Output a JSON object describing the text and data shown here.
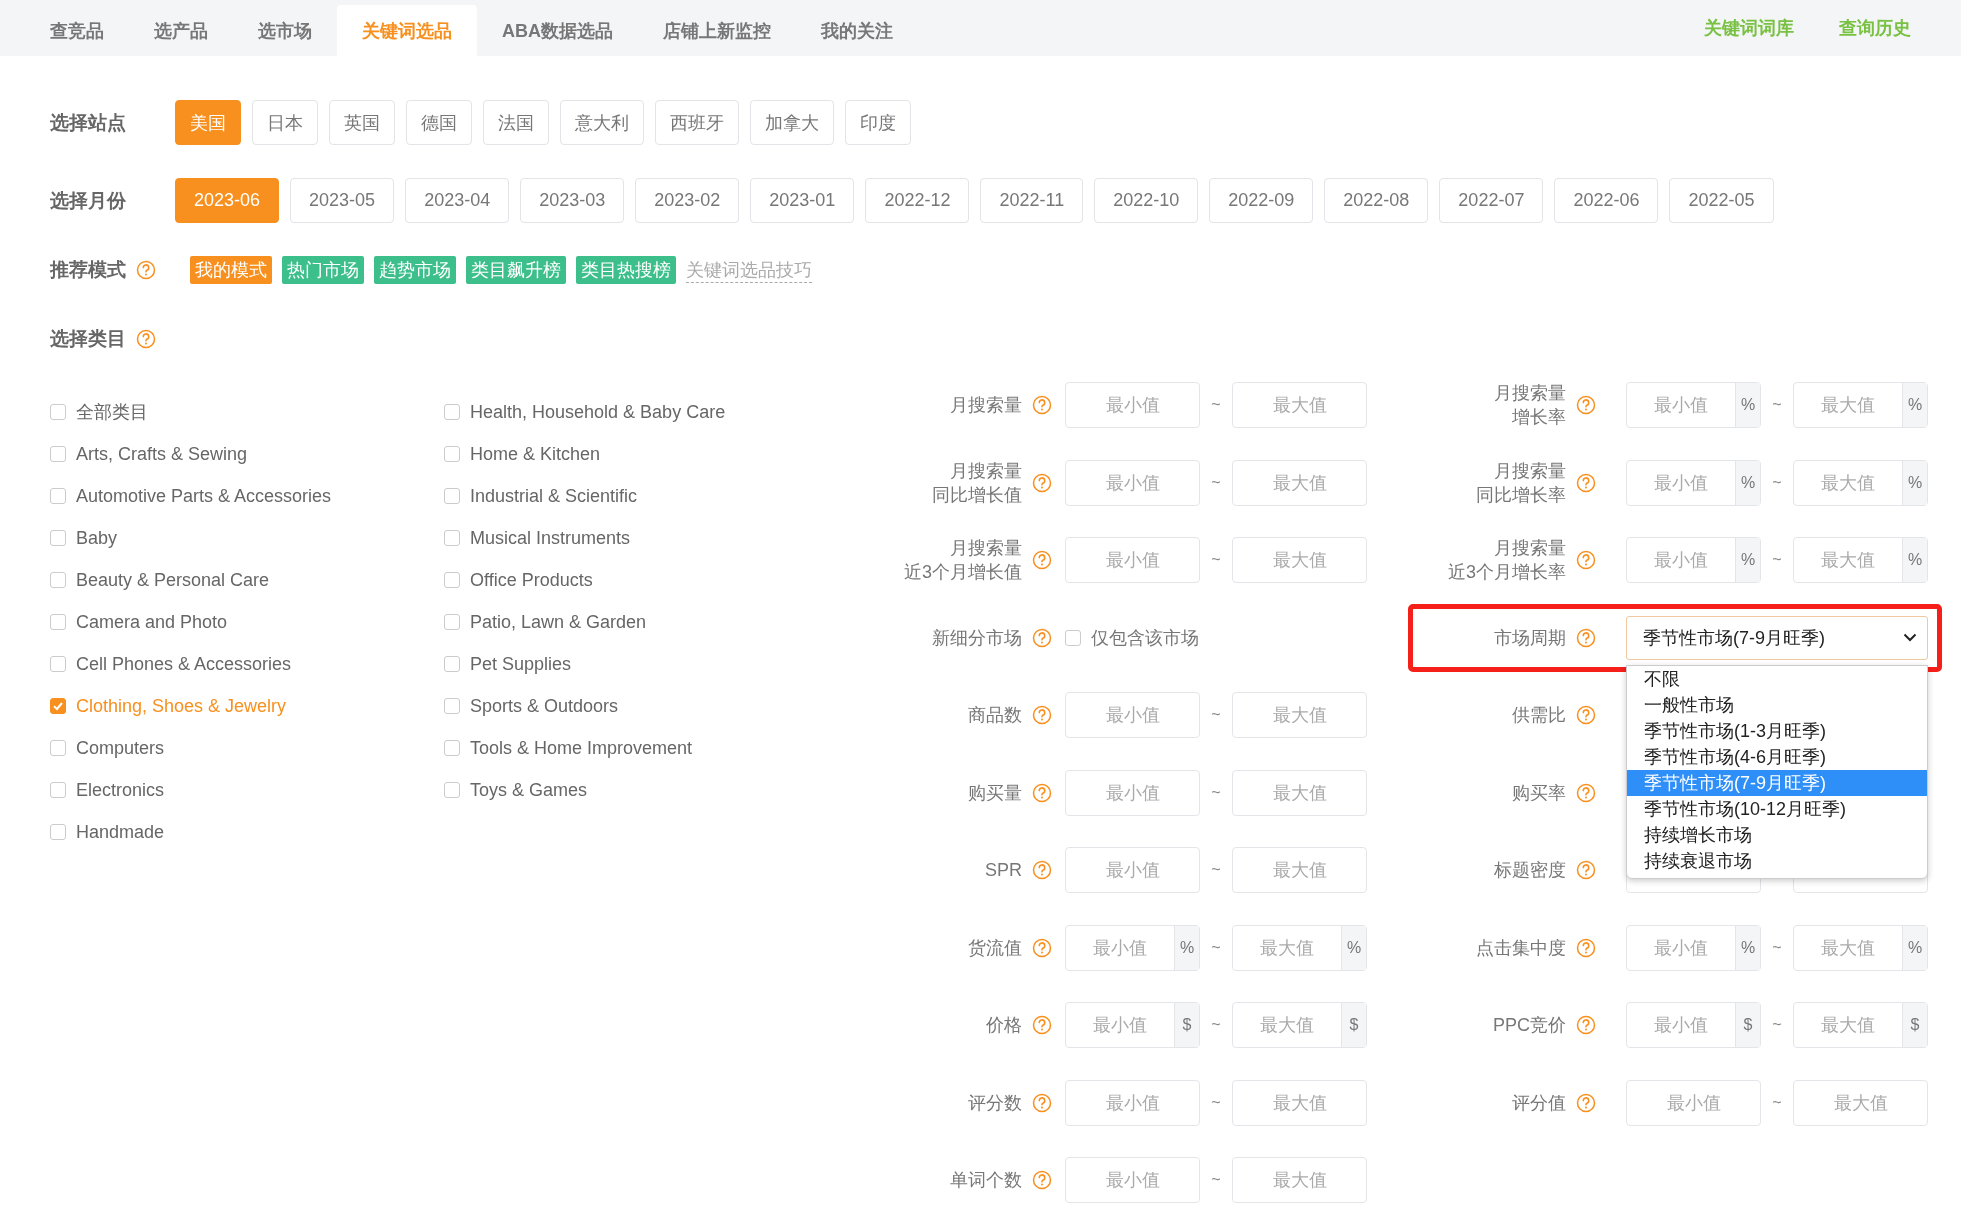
{
  "nav": {
    "tabs": [
      {
        "label": "查竞品",
        "selected": false
      },
      {
        "label": "选产品",
        "selected": false
      },
      {
        "label": "选市场",
        "selected": false
      },
      {
        "label": "关键词选品",
        "selected": true
      },
      {
        "label": "ABA数据选品",
        "selected": false
      },
      {
        "label": "店铺上新监控",
        "selected": false
      },
      {
        "label": "我的关注",
        "selected": false
      }
    ],
    "links": [
      "关键词词库",
      "查询历史"
    ]
  },
  "sites": {
    "label": "选择站点",
    "options": [
      {
        "label": "美国",
        "selected": true
      },
      {
        "label": "日本",
        "selected": false
      },
      {
        "label": "英国",
        "selected": false
      },
      {
        "label": "德国",
        "selected": false
      },
      {
        "label": "法国",
        "selected": false
      },
      {
        "label": "意大利",
        "selected": false
      },
      {
        "label": "西班牙",
        "selected": false
      },
      {
        "label": "加拿大",
        "selected": false
      },
      {
        "label": "印度",
        "selected": false
      }
    ]
  },
  "months": {
    "label": "选择月份",
    "options": [
      {
        "label": "2023-06",
        "selected": true
      },
      {
        "label": "2023-05",
        "selected": false
      },
      {
        "label": "2023-04",
        "selected": false
      },
      {
        "label": "2023-03",
        "selected": false
      },
      {
        "label": "2023-02",
        "selected": false
      },
      {
        "label": "2023-01",
        "selected": false
      },
      {
        "label": "2022-12",
        "selected": false
      },
      {
        "label": "2022-11",
        "selected": false
      },
      {
        "label": "2022-10",
        "selected": false
      },
      {
        "label": "2022-09",
        "selected": false
      },
      {
        "label": "2022-08",
        "selected": false
      },
      {
        "label": "2022-07",
        "selected": false
      },
      {
        "label": "2022-06",
        "selected": false
      },
      {
        "label": "2022-05",
        "selected": false
      }
    ]
  },
  "modes": {
    "label": "推荐模式",
    "tags": [
      {
        "label": "我的模式",
        "color": "#f7901e"
      },
      {
        "label": "热门市场",
        "color": "#3cbf8a"
      },
      {
        "label": "趋势市场",
        "color": "#3cbf8a"
      },
      {
        "label": "类目飙升榜",
        "color": "#3cbf8a"
      },
      {
        "label": "类目热搜榜",
        "color": "#3cbf8a"
      }
    ],
    "link": "关键词选品技巧"
  },
  "categories": {
    "label": "选择类目",
    "items": [
      {
        "label": "全部类目",
        "checked": false
      },
      {
        "label": "Arts, Crafts & Sewing",
        "checked": false
      },
      {
        "label": "Automotive Parts & Accessories",
        "checked": false
      },
      {
        "label": "Baby",
        "checked": false
      },
      {
        "label": "Beauty & Personal Care",
        "checked": false
      },
      {
        "label": "Camera and Photo",
        "checked": false
      },
      {
        "label": "Cell Phones & Accessories",
        "checked": false
      },
      {
        "label": "Clothing, Shoes & Jewelry",
        "checked": true
      },
      {
        "label": "Computers",
        "checked": false
      },
      {
        "label": "Electronics",
        "checked": false
      },
      {
        "label": "Handmade",
        "checked": false
      },
      {
        "label": "Health, Household & Baby Care",
        "checked": false
      },
      {
        "label": "Home & Kitchen",
        "checked": false
      },
      {
        "label": "Industrial & Scientific",
        "checked": false
      },
      {
        "label": "Musical Instruments",
        "checked": false
      },
      {
        "label": "Office Products",
        "checked": false
      },
      {
        "label": "Patio, Lawn & Garden",
        "checked": false
      },
      {
        "label": "Pet Supplies",
        "checked": false
      },
      {
        "label": "Sports & Outdoors",
        "checked": false
      },
      {
        "label": "Tools & Home Improvement",
        "checked": false
      },
      {
        "label": "Toys & Games",
        "checked": false
      }
    ]
  },
  "filters": [
    {
      "left": {
        "kind": "range",
        "label": "月搜索量",
        "min": "最小值",
        "sep": "~",
        "max": "最大值"
      },
      "right": {
        "kind": "range",
        "label": [
          "月搜索量",
          "增长率"
        ],
        "min": "最小值",
        "sep": "~",
        "max": "最大值",
        "unit": "%"
      }
    },
    {
      "left": {
        "kind": "range",
        "label": [
          "月搜索量",
          "同比增长值"
        ],
        "min": "最小值",
        "sep": "~",
        "max": "最大值"
      },
      "right": {
        "kind": "range",
        "label": [
          "月搜索量",
          "同比增长率"
        ],
        "min": "最小值",
        "sep": "~",
        "max": "最大值",
        "unit": "%"
      }
    },
    {
      "left": {
        "kind": "range",
        "label": [
          "月搜索量",
          "近3个月增长值"
        ],
        "min": "最小值",
        "sep": "~",
        "max": "最大值"
      },
      "right": {
        "kind": "range",
        "label": [
          "月搜索量",
          "近3个月增长率"
        ],
        "min": "最小值",
        "sep": "~",
        "max": "最大值",
        "unit": "%"
      }
    },
    {
      "left": {
        "kind": "checkbox",
        "label": "新细分市场",
        "text": "仅包含该市场",
        "checked": false
      },
      "right": {
        "kind": "select",
        "label": "市场周期",
        "value": "季节性市场(7-9月旺季)",
        "open": true,
        "highlighted": true,
        "options": [
          {
            "label": "不限",
            "selected": false
          },
          {
            "label": "一般性市场",
            "selected": false
          },
          {
            "label": "季节性市场(1-3月旺季)",
            "selected": false
          },
          {
            "label": "季节性市场(4-6月旺季)",
            "selected": false
          },
          {
            "label": "季节性市场(7-9月旺季)",
            "selected": true
          },
          {
            "label": "季节性市场(10-12月旺季)",
            "selected": false
          },
          {
            "label": "持续增长市场",
            "selected": false
          },
          {
            "label": "持续衰退市场",
            "selected": false
          }
        ]
      }
    },
    {
      "left": {
        "kind": "range",
        "label": "商品数",
        "min": "最小值",
        "sep": "~",
        "max": "最大值"
      },
      "right": {
        "kind": "covered",
        "label": "供需比"
      }
    },
    {
      "left": {
        "kind": "range",
        "label": "购买量",
        "min": "最小值",
        "sep": "~",
        "max": "最大值"
      },
      "right": {
        "kind": "covered",
        "label": "购买率"
      }
    },
    {
      "left": {
        "kind": "range",
        "label": "SPR",
        "min": "最小值",
        "sep": "~",
        "max": "最大值"
      },
      "right": {
        "kind": "covered",
        "label": "标题密度"
      }
    },
    {
      "left": {
        "kind": "range",
        "label": "货流值",
        "min": "最小值",
        "sep": "~",
        "max": "最大值",
        "unit": "%"
      },
      "right": {
        "kind": "range",
        "label": "点击集中度",
        "min": "最小值",
        "sep": "~",
        "max": "最大值",
        "unit": "%"
      }
    },
    {
      "left": {
        "kind": "range",
        "label": "价格",
        "min": "最小值",
        "sep": "~",
        "max": "最大值",
        "unit": "$"
      },
      "right": {
        "kind": "range",
        "label": "PPC竞价",
        "min": "最小值",
        "sep": "~",
        "max": "最大值",
        "unit": "$"
      }
    },
    {
      "left": {
        "kind": "range",
        "label": "评分数",
        "min": "最小值",
        "sep": "~",
        "max": "最大值"
      },
      "right": {
        "kind": "range",
        "label": "评分值",
        "min": "最小值",
        "sep": "~",
        "max": "最大值"
      }
    },
    {
      "left": {
        "kind": "range",
        "label": "单词个数",
        "min": "最小值",
        "sep": "~",
        "max": "最大值"
      }
    }
  ]
}
